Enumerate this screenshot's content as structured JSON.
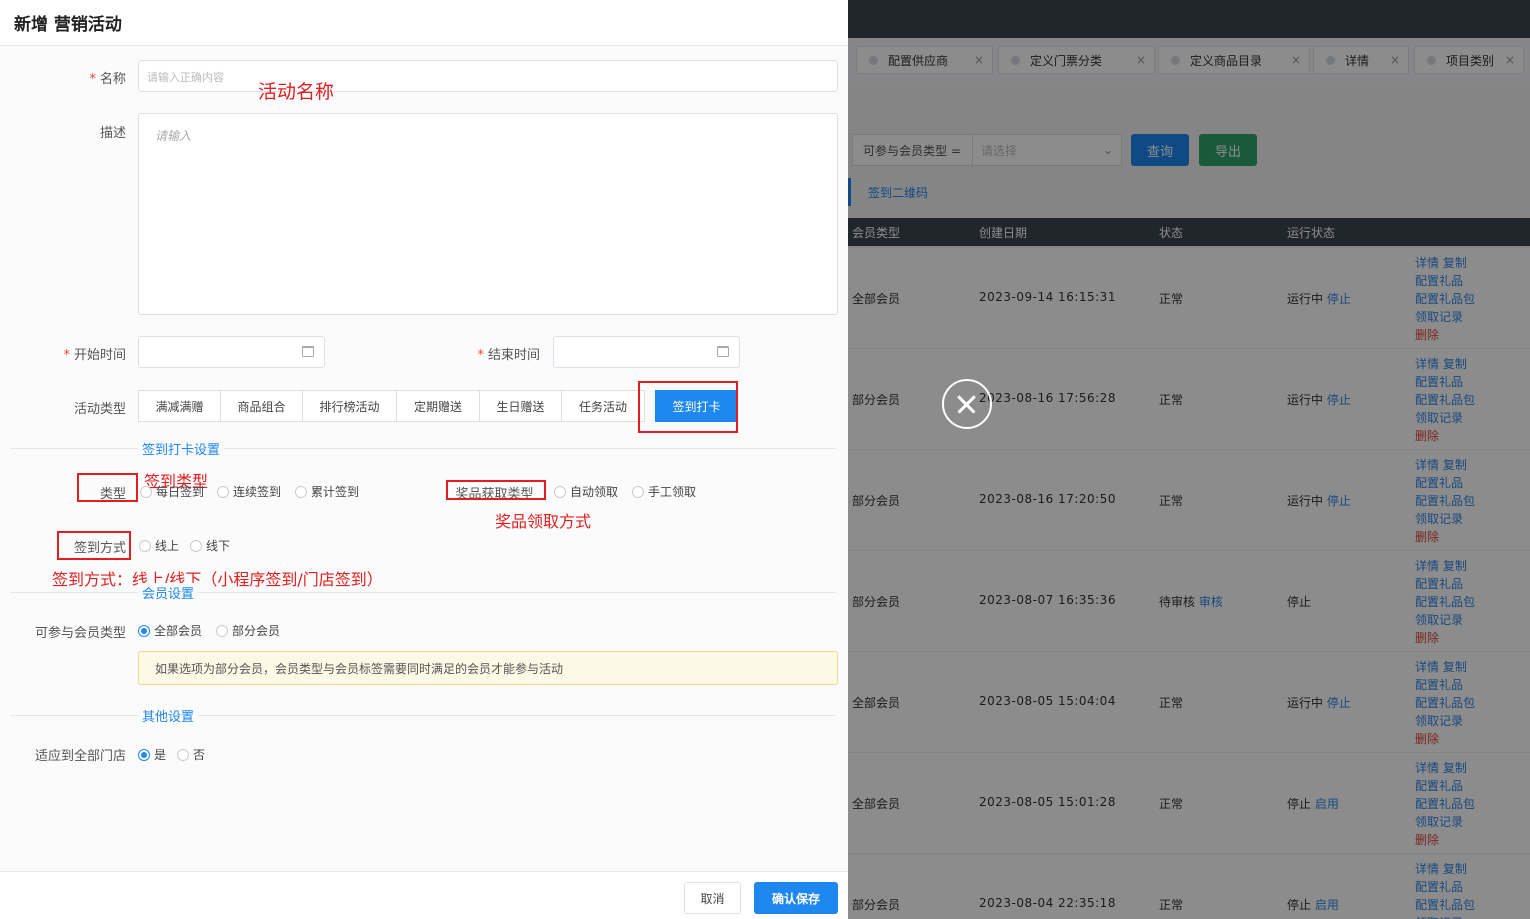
{
  "drawer": {
    "title": "新增 营销活动",
    "fields": {
      "name_label": "名称",
      "name_placeholder": "请输入正确内容",
      "desc_label": "描述",
      "desc_placeholder": "请输入",
      "start_label": "开始时间",
      "end_label": "结束时间",
      "activity_type_label": "活动类型"
    },
    "activity_types": [
      "满减满赠",
      "商品组合",
      "排行榜活动",
      "定期赠送",
      "生日赠送",
      "任务活动",
      "签到打卡"
    ],
    "sections": {
      "checkin": "签到打卡设置",
      "member": "会员设置",
      "other": "其他设置"
    },
    "checkin": {
      "type_label": "类型",
      "type_options": [
        "每日签到",
        "连续签到",
        "累计签到"
      ],
      "prize_label": "奖品获取类型",
      "prize_options": [
        "自动领取",
        "手工领取"
      ],
      "method_label": "签到方式",
      "method_options": [
        "线上",
        "线下"
      ]
    },
    "member": {
      "label": "可参与会员类型",
      "options": [
        "全部会员",
        "部分会员"
      ],
      "notice": "如果选项为部分会员，会员类型与会员标签需要同时满足的会员才能参与活动"
    },
    "other": {
      "label": "适应到全部门店",
      "options": [
        "是",
        "否"
      ]
    },
    "footer": {
      "cancel": "取消",
      "save": "确认保存"
    }
  },
  "annotations": {
    "name": "活动名称",
    "type": "签到类型",
    "prize": "奖品领取方式",
    "method": "签到方式：线上/线下（小程序签到/门店签到）"
  },
  "background": {
    "tabs": [
      "配置供应商",
      "定义门票分类",
      "定义商品目录",
      "详情",
      "项目类别"
    ],
    "filter_label": "可参与会员类型 =",
    "filter_placeholder": "请选择",
    "query": "查询",
    "export": "导出",
    "qrcode": "签到二维码",
    "headers": [
      "会员类型",
      "创建日期",
      "状态",
      "运行状态"
    ],
    "rows": [
      {
        "member": "全部会员",
        "date": "2023-09-14 16:15:31",
        "status": "正常",
        "run": "运行中",
        "action": "停止"
      },
      {
        "member": "部分会员",
        "date": "2023-08-16 17:56:28",
        "status": "正常",
        "run": "运行中",
        "action": "停止"
      },
      {
        "member": "部分会员",
        "date": "2023-08-16 17:20:50",
        "status": "正常",
        "run": "运行中",
        "action": "停止"
      },
      {
        "member": "部分会员",
        "date": "2023-08-07 16:35:36",
        "status": "待审核",
        "status_action": "审核",
        "run": "停止",
        "action": ""
      },
      {
        "member": "全部会员",
        "date": "2023-08-05 15:04:04",
        "status": "正常",
        "run": "运行中",
        "action": "停止"
      },
      {
        "member": "全部会员",
        "date": "2023-08-05 15:01:28",
        "status": "正常",
        "run": "停止",
        "action": "启用"
      },
      {
        "member": "部分会员",
        "date": "2023-08-04 22:35:18",
        "status": "正常",
        "run": "停止",
        "action": "启用"
      }
    ],
    "ops": {
      "detail": "详情",
      "copy": "复制",
      "gift": "配置礼品",
      "gift_pack": "配置礼品包",
      "records": "领取记录",
      "delete": "删除"
    }
  },
  "colors": {
    "primary": "#1e87f0",
    "annotation": "#e02020",
    "export": "#2ea46a",
    "dark_header": "#3d4450"
  }
}
